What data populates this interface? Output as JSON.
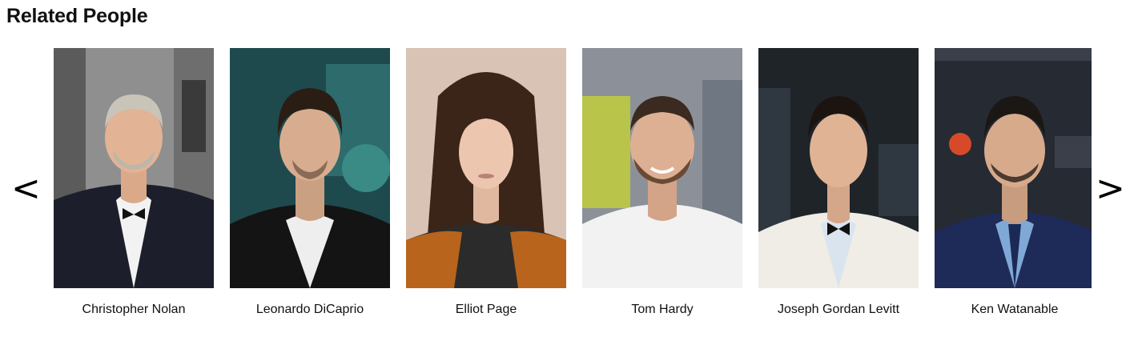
{
  "section": {
    "title": "Related People"
  },
  "carousel": {
    "prev_label": "<",
    "next_label": ">",
    "people": [
      {
        "name": "Christopher Nolan"
      },
      {
        "name": "Leonardo DiCaprio"
      },
      {
        "name": "Elliot Page"
      },
      {
        "name": "Tom Hardy"
      },
      {
        "name": "Joseph Gordan Levitt"
      },
      {
        "name": "Ken Watanable"
      }
    ]
  }
}
